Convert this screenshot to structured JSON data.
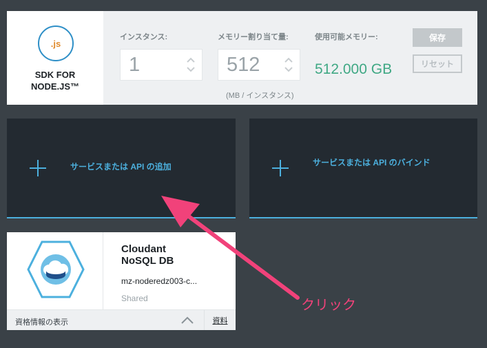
{
  "runtime": {
    "logo_text": ".js",
    "name_line1": "SDK FOR",
    "name_line2": "NODE.JS™",
    "instances_label": "インスタンス:",
    "instances_value": "1",
    "memory_label": "メモリー割り当て量:",
    "memory_value": "512",
    "memory_units": "(MB / インスタンス)",
    "available_label": "使用可能メモリー:",
    "available_value": "512.000 GB",
    "save_label": "保存",
    "reset_label": "リセット"
  },
  "tiles": {
    "add_service_label": "サービスまたは API の追加",
    "bind_service_label": "サービスまたは API のバインド"
  },
  "service_card": {
    "title_line1": "Cloudant",
    "title_line2": "NoSQL DB",
    "instance_name": "mz-noderedz003-c...",
    "plan": "Shared",
    "pricing_link": "資格情報の表示",
    "docs_link": "資料",
    "icon": "cloudant-icon"
  },
  "annotation": {
    "text": "クリック"
  },
  "colors": {
    "accent_blue": "#4cb0de",
    "memory_green": "#3fa884",
    "annotation_pink": "#f1427a",
    "dark_tile": "#232a31",
    "background": "#3a4147"
  }
}
